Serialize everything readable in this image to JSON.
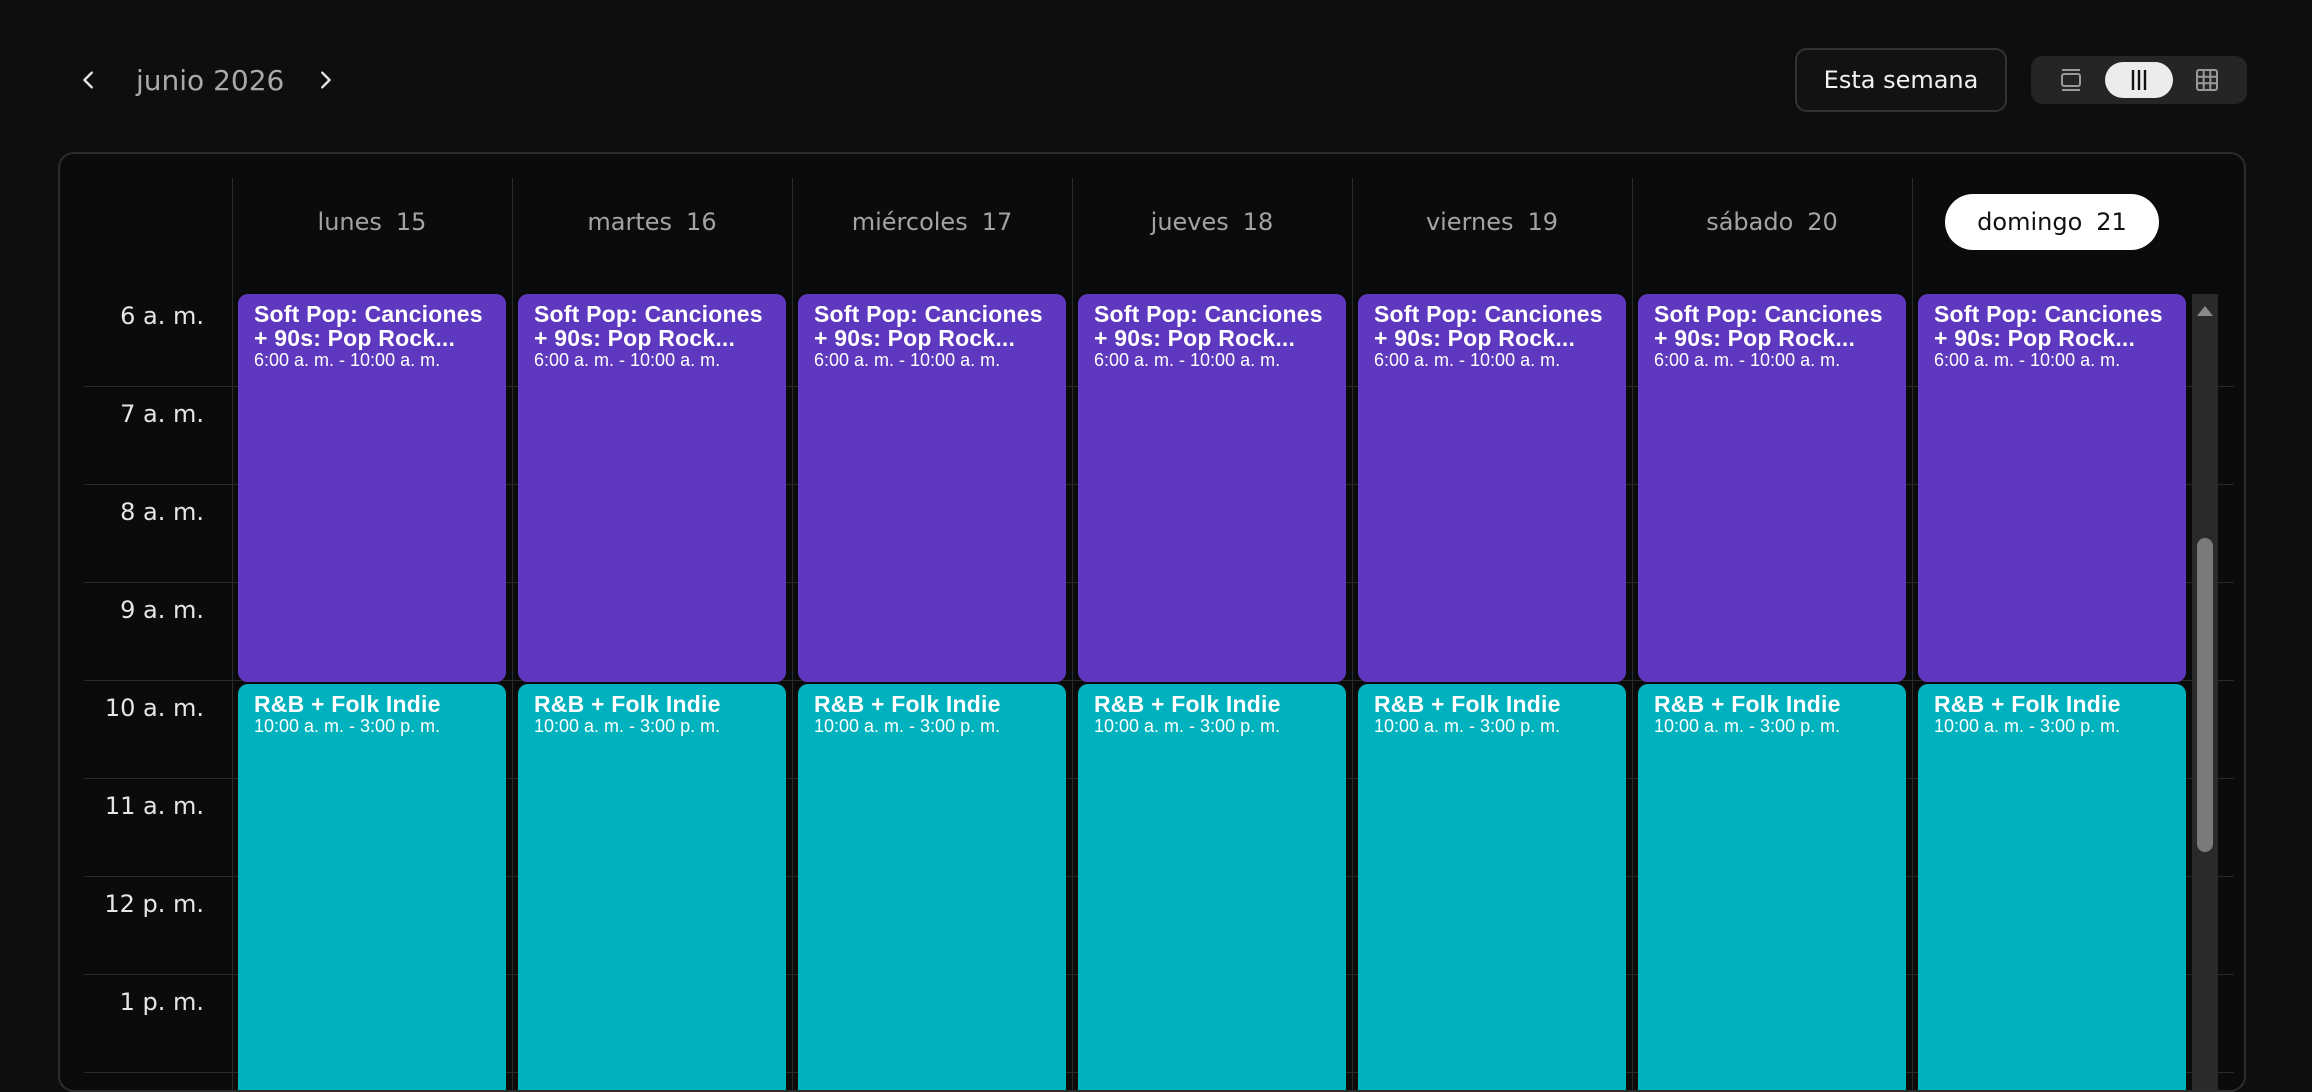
{
  "header": {
    "month_label": "junio 2026",
    "today_button": "Esta semana",
    "prev_icon": "chevron-left-icon",
    "next_icon": "chevron-right-icon",
    "views": [
      {
        "name": "day-view-icon",
        "active": false
      },
      {
        "name": "week-view-icon",
        "active": true
      },
      {
        "name": "month-view-icon",
        "active": false
      }
    ]
  },
  "days": [
    {
      "name": "lunes",
      "num": "15",
      "today": false
    },
    {
      "name": "martes",
      "num": "16",
      "today": false
    },
    {
      "name": "miércoles",
      "num": "17",
      "today": false
    },
    {
      "name": "jueves",
      "num": "18",
      "today": false
    },
    {
      "name": "viernes",
      "num": "19",
      "today": false
    },
    {
      "name": "sábado",
      "num": "20",
      "today": false
    },
    {
      "name": "domingo",
      "num": "21",
      "today": true
    }
  ],
  "time_labels": [
    "6 a. m.",
    "7 a. m.",
    "8 a. m.",
    "9 a. m.",
    "10 a. m.",
    "11 a. m.",
    "12 p. m.",
    "1 p. m."
  ],
  "events": {
    "morning": {
      "title": "Soft Pop: Canciones + 90s: Pop Rock...",
      "time": "6:00 a. m. - 10:00 a. m.",
      "color": "#5e39c0"
    },
    "midday": {
      "title": "R&B + Folk Indie",
      "time": "10:00 a. m. - 3:00 p. m.",
      "color": "#00b2bd"
    }
  },
  "colors": {
    "background": "#0e0e0e",
    "today_pill": "#ffffff",
    "grid_line": "#2c2c2c"
  }
}
